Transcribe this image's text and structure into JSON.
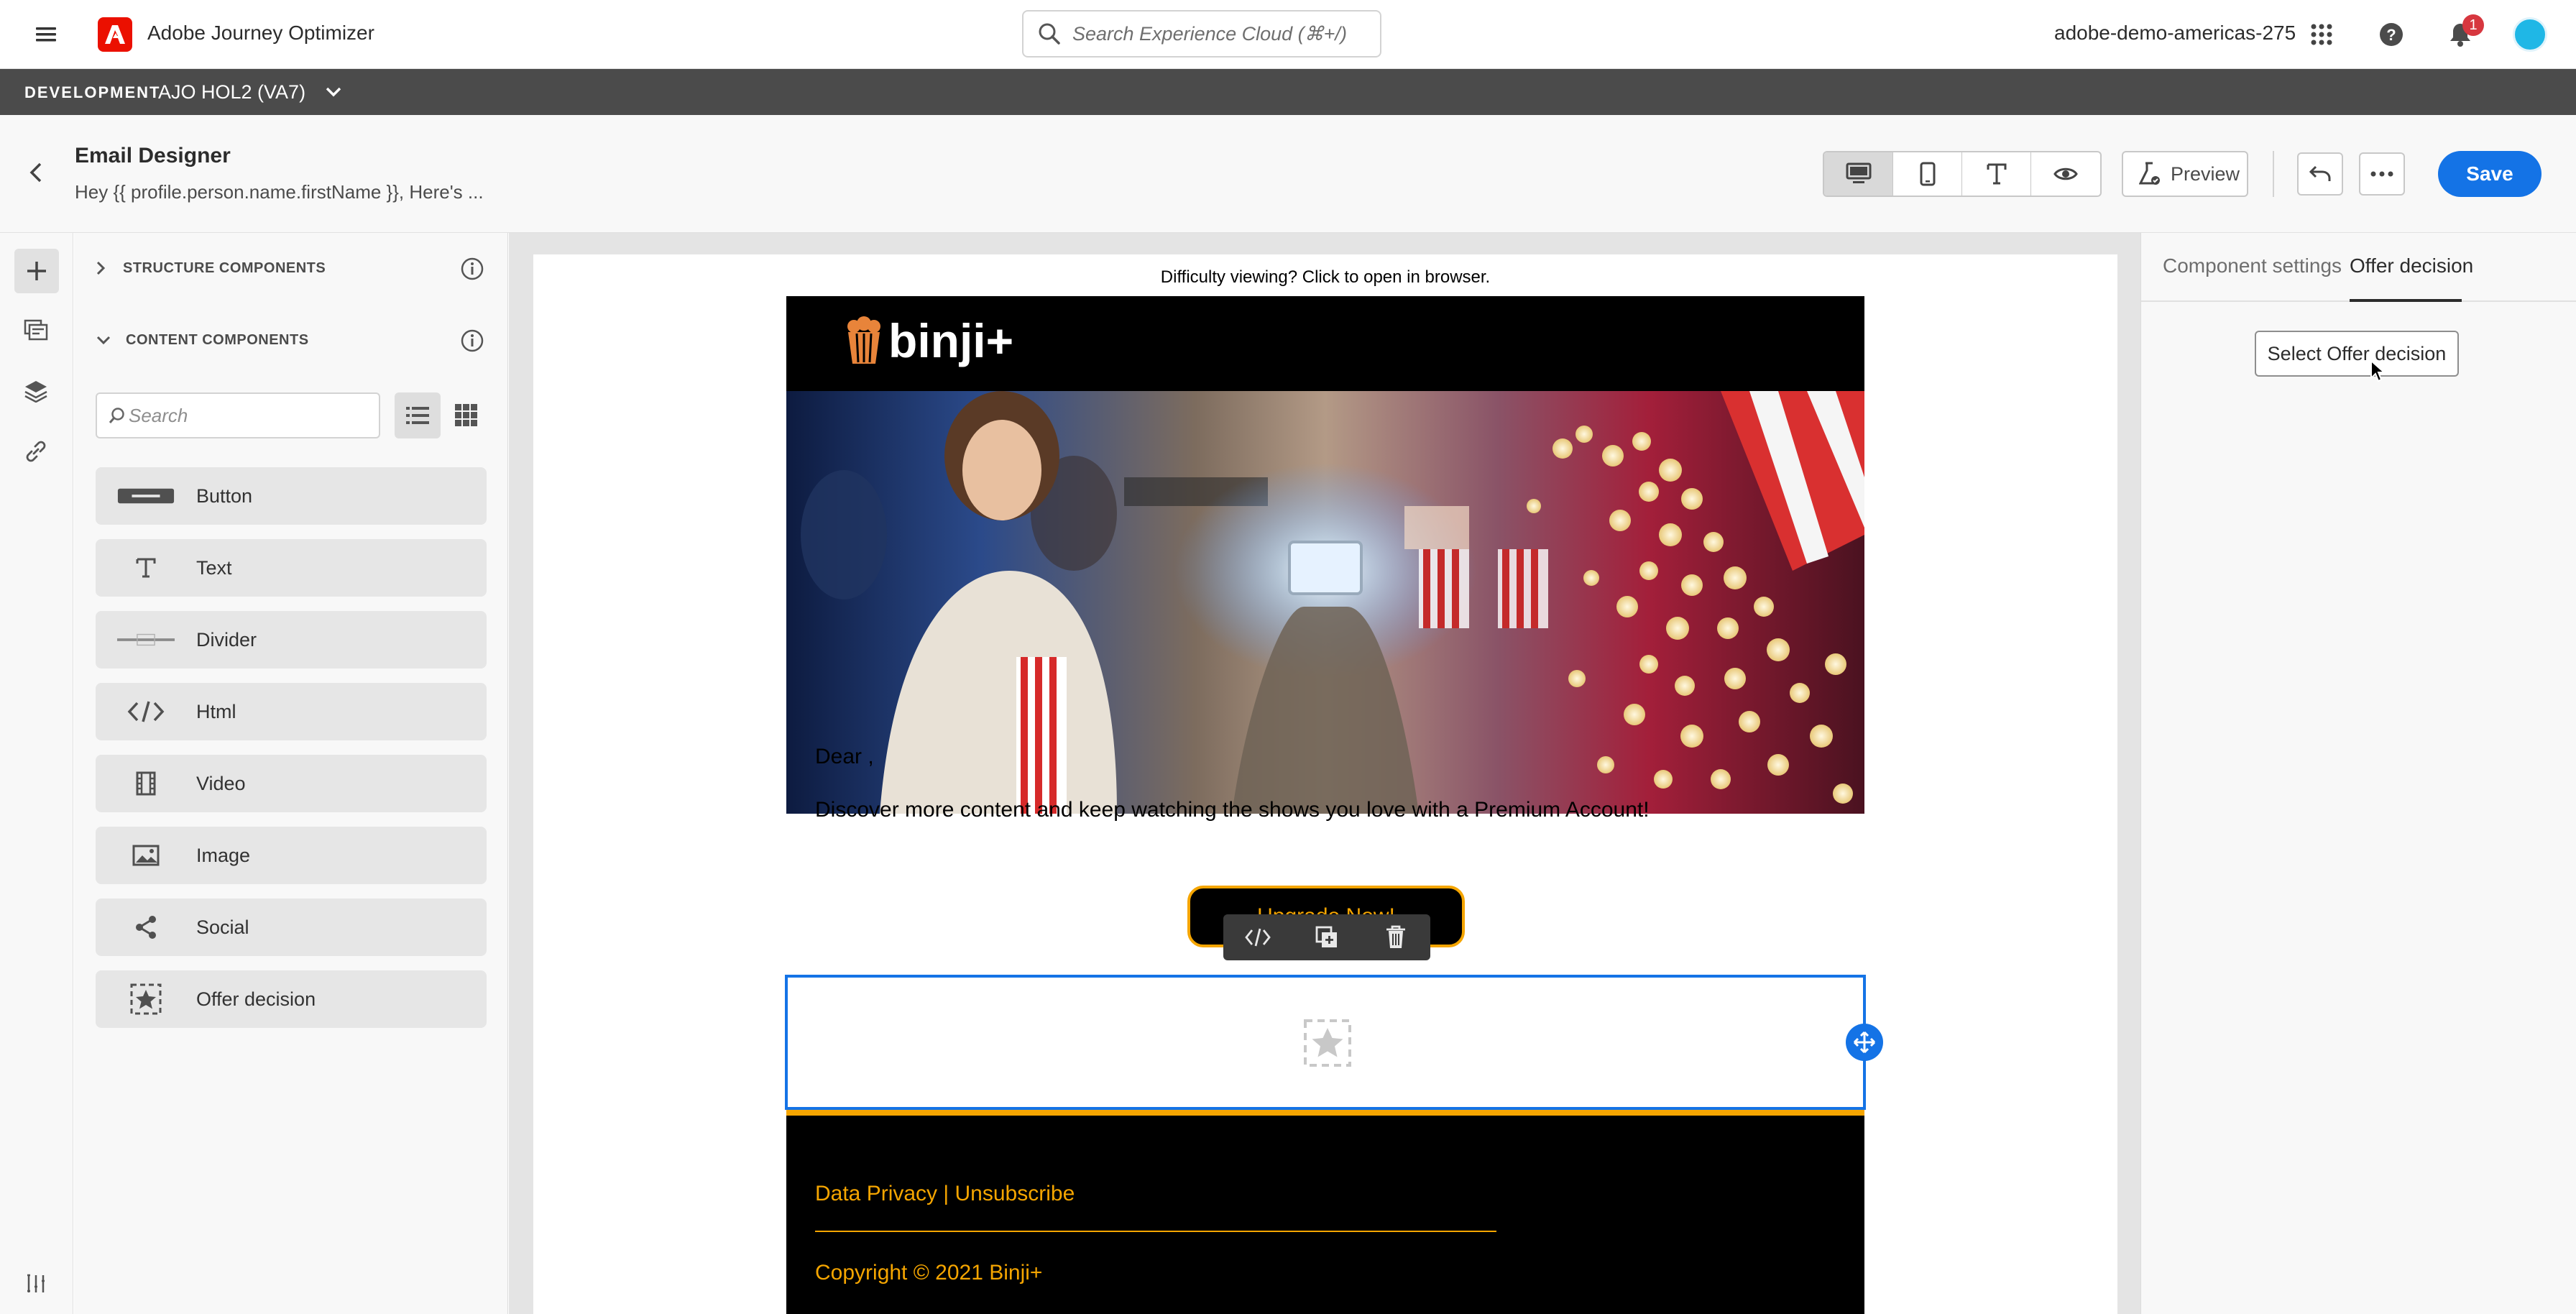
{
  "topbar": {
    "app_name": "Adobe Journey Optimizer",
    "search_placeholder": "Search Experience Cloud (⌘+/)",
    "org_name": "adobe-demo-americas-275",
    "notification_count": "1"
  },
  "devbar": {
    "env_label": "DEVELOPMENT",
    "sandbox_name": "AJO HOL2 (VA7)"
  },
  "header": {
    "title": "Email Designer",
    "subject": "Hey {{ profile.person.name.firstName }}, Here's ...",
    "preview_label": "Preview",
    "save_label": "Save"
  },
  "leftpanel": {
    "structure_label": "STRUCTURE COMPONENTS",
    "content_label": "CONTENT COMPONENTS",
    "search_placeholder": "Search",
    "components": [
      {
        "label": "Button",
        "icon": "button-icon"
      },
      {
        "label": "Text",
        "icon": "text-icon"
      },
      {
        "label": "Divider",
        "icon": "divider-icon"
      },
      {
        "label": "Html",
        "icon": "html-icon"
      },
      {
        "label": "Video",
        "icon": "video-icon"
      },
      {
        "label": "Image",
        "icon": "image-icon"
      },
      {
        "label": "Social",
        "icon": "share-icon"
      },
      {
        "label": "Offer decision",
        "icon": "offer-decision-icon"
      }
    ]
  },
  "email": {
    "browser_link": "Difficulty viewing? Click to open in browser.",
    "logo_text": "binji+",
    "greeting": "Dear ,",
    "body_text": "Discover more content and keep watching the shows you love with a Premium Account!",
    "cta_label": "Upgrade Now!",
    "footer_links": "Data Privacy | Unsubscribe",
    "copyright": "Copyright © 2021 Binji+"
  },
  "rightpanel": {
    "tabs": [
      "Component settings",
      "Offer decision"
    ],
    "active_tab": "Offer decision",
    "select_button": "Select Offer decision"
  },
  "colors": {
    "accent_blue": "#1473e6",
    "adobe_red": "#eb1000",
    "gold": "#f5a500",
    "devbar": "#4b4b4b"
  }
}
